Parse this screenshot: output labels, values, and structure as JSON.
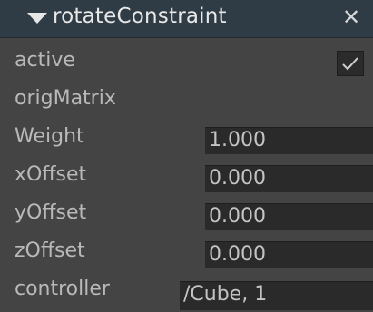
{
  "panel": {
    "title": "rotateConstraint",
    "collapse_icon": "triangle-down-icon",
    "close_icon": "close-icon",
    "close_glyph": "✕"
  },
  "attributes": [
    {
      "label": "active",
      "type": "checkbox",
      "checked": true
    },
    {
      "label": "origMatrix",
      "type": "label"
    },
    {
      "label": "Weight",
      "type": "float",
      "value": "1.000"
    },
    {
      "label": "xOffset",
      "type": "float",
      "value": "0.000"
    },
    {
      "label": "yOffset",
      "type": "float",
      "value": "0.000"
    },
    {
      "label": "zOffset",
      "type": "float",
      "value": "0.000"
    },
    {
      "label": "controller",
      "type": "text",
      "value": "/Cube, 1"
    }
  ],
  "colors": {
    "header_bg": "#2f3b45",
    "panel_bg": "#444444",
    "field_bg": "#2a2a2a",
    "text": "#bdbdbd"
  }
}
